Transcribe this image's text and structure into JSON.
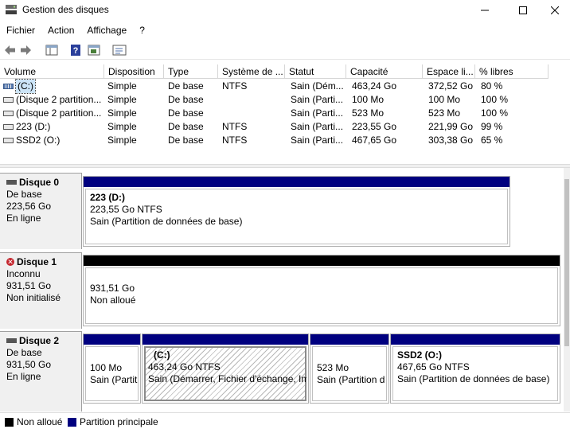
{
  "window": {
    "title": "Gestion des disques",
    "minimize": "—",
    "maximize": "☐",
    "close": "✕"
  },
  "menu": [
    "Fichier",
    "Action",
    "Affichage",
    "?"
  ],
  "toolbar": {
    "icons": [
      "back-arrow-icon",
      "forward-arrow-icon",
      "console-tree-icon",
      "help-icon",
      "action-pane-icon",
      "properties-icon"
    ]
  },
  "volume_list": {
    "columns": [
      "Volume",
      "Disposition",
      "Type",
      "Système de ...",
      "Statut",
      "Capacité",
      "Espace li...",
      "% libres"
    ],
    "rows": [
      {
        "volume": "(C:)",
        "disposition": "Simple",
        "type": "De base",
        "fs": "NTFS",
        "status": "Sain (Dém...",
        "capacity": "463,24 Go",
        "free": "372,52 Go",
        "pct": "80 %",
        "selected": true
      },
      {
        "volume": "(Disque 2 partition...",
        "disposition": "Simple",
        "type": "De base",
        "fs": "",
        "status": "Sain (Parti...",
        "capacity": "100 Mo",
        "free": "100 Mo",
        "pct": "100 %"
      },
      {
        "volume": "(Disque 2 partition...",
        "disposition": "Simple",
        "type": "De base",
        "fs": "",
        "status": "Sain (Parti...",
        "capacity": "523 Mo",
        "free": "523 Mo",
        "pct": "100 %"
      },
      {
        "volume": "223 (D:)",
        "disposition": "Simple",
        "type": "De base",
        "fs": "NTFS",
        "status": "Sain (Parti...",
        "capacity": "223,55 Go",
        "free": "221,99 Go",
        "pct": "99 %"
      },
      {
        "volume": "SSD2 (O:)",
        "disposition": "Simple",
        "type": "De base",
        "fs": "NTFS",
        "status": "Sain (Parti...",
        "capacity": "467,65 Go",
        "free": "303,38 Go",
        "pct": "65 %"
      }
    ]
  },
  "disks": [
    {
      "name": "Disque 0",
      "line1": "De base",
      "line2": "223,56 Go",
      "line3": "En ligne",
      "partitions": [
        {
          "title": "223  (D:)",
          "size": "223,55 Go NTFS",
          "status": "Sain (Partition de données de base)"
        }
      ]
    },
    {
      "name": "Disque 1",
      "line1": "Inconnu",
      "line2": "931,51 Go",
      "line3": "Non initialisé",
      "partitions": [
        {
          "size": "931,51 Go",
          "status": "Non alloué"
        }
      ]
    },
    {
      "name": "Disque 2",
      "line1": "De base",
      "line2": "931,50 Go",
      "line3": "En ligne",
      "partitions": [
        {
          "size": "100 Mo",
          "status": "Sain (Partit"
        },
        {
          "title": "(C:)",
          "size": "463,24 Go NTFS",
          "status": "Sain (Démarrer, Fichier d'échange, Im"
        },
        {
          "size": "523 Mo",
          "status": "Sain (Partition d"
        },
        {
          "title": "SSD2  (O:)",
          "size": "467,65 Go NTFS",
          "status": "Sain (Partition de données de base)"
        }
      ]
    }
  ],
  "legend": [
    {
      "label": "Non alloué",
      "color": "#000000"
    },
    {
      "label": "Partition principale",
      "color": "#00007f"
    }
  ]
}
